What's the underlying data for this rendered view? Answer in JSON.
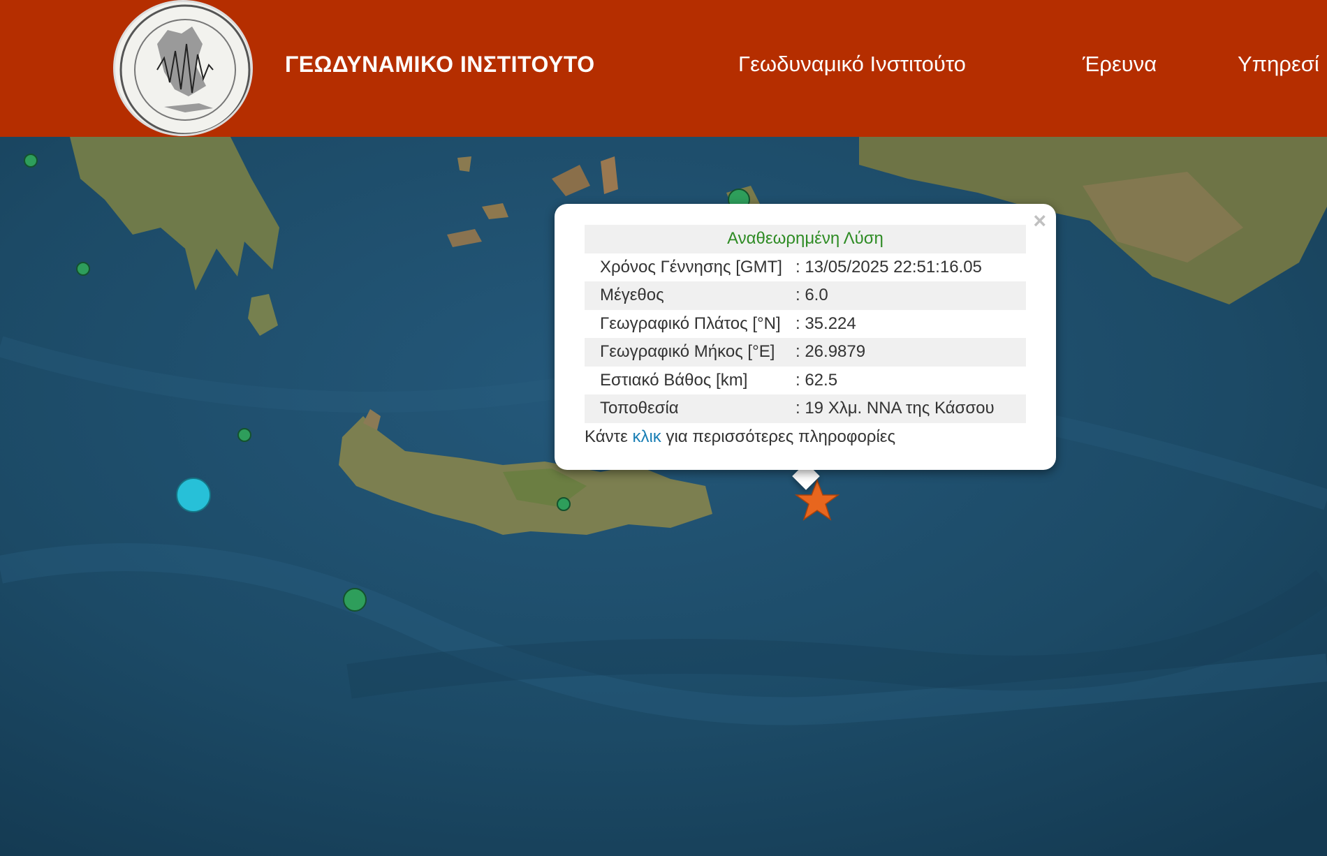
{
  "header": {
    "title": "ΓΕΩΔΥΝΑΜΙΚΟ ΙΝΣΤΙΤΟΥΤΟ",
    "background": "#b52e00",
    "nav": [
      {
        "label": "Γεωδυναμικό Ινστιτούτο"
      },
      {
        "label": "Έρευνα"
      },
      {
        "label": "Υπηρεσί"
      }
    ]
  },
  "popup": {
    "close_symbol": "×",
    "title": "Αναθεωρημένη Λύση",
    "rows": [
      {
        "label": "Χρόνος Γέννησης [GMT]",
        "value": ": 13/05/2025 22:51:16.05"
      },
      {
        "label": "Μέγεθος",
        "value": ": 6.0"
      },
      {
        "label": "Γεωγραφικό Πλάτος [°N]",
        "value": ": 35.224"
      },
      {
        "label": "Γεωγραφικό Μήκος [°E]",
        "value": ": 26.9879"
      },
      {
        "label": "Εστιακό Βάθος [km]",
        "value": ": 62.5"
      },
      {
        "label": "Τοποθεσία",
        "value": ": 19 Χλμ. ΝΝΑ της Κάσσου"
      }
    ],
    "footer": {
      "before": "Κάντε",
      "link": "κλικ",
      "after": "για περισσότερες πληροφορίες"
    }
  },
  "map": {
    "epicenter_icon": "star-icon",
    "epicenter_color": "#e8661e",
    "event_marker_colors": [
      "#2e9e5b",
      "#27c0d8"
    ]
  }
}
